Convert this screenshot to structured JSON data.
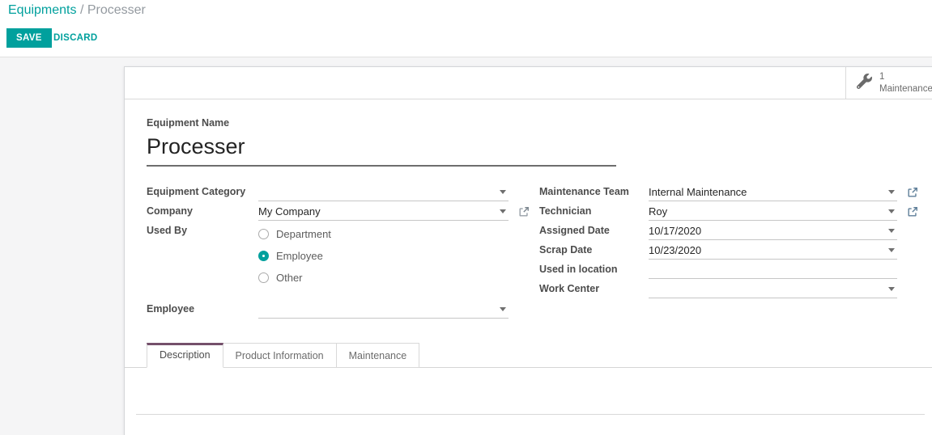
{
  "breadcrumb": {
    "parent": "Equipments",
    "separator": "/",
    "current": "Processer"
  },
  "toolbar": {
    "save_label": "SAVE",
    "discard_label": "DISCARD"
  },
  "stat_button": {
    "count": "1",
    "label": "Maintenance"
  },
  "form": {
    "name_label": "Equipment Name",
    "name_value": "Processer",
    "fields": {
      "equipment_category": {
        "label": "Equipment Category",
        "value": ""
      },
      "company": {
        "label": "Company",
        "value": "My Company"
      },
      "used_by": {
        "label": "Used By",
        "options": [
          {
            "label": "Department",
            "selected": false
          },
          {
            "label": "Employee",
            "selected": true
          },
          {
            "label": "Other",
            "selected": false
          }
        ]
      },
      "employee": {
        "label": "Employee",
        "value": ""
      },
      "maintenance_team": {
        "label": "Maintenance Team",
        "value": "Internal Maintenance"
      },
      "technician": {
        "label": "Technician",
        "value": "Roy"
      },
      "assigned_date": {
        "label": "Assigned Date",
        "value": "10/17/2020"
      },
      "scrap_date": {
        "label": "Scrap Date",
        "value": "10/23/2020"
      },
      "used_in_location": {
        "label": "Used in location",
        "value": ""
      },
      "work_center": {
        "label": "Work Center",
        "value": ""
      }
    }
  },
  "tabs": [
    {
      "label": "Description",
      "active": true
    },
    {
      "label": "Product Information",
      "active": false
    },
    {
      "label": "Maintenance",
      "active": false
    }
  ],
  "colors": {
    "accent_teal": "#00a09d",
    "tab_accent": "#74506b",
    "label_text": "#4c4c4c"
  }
}
